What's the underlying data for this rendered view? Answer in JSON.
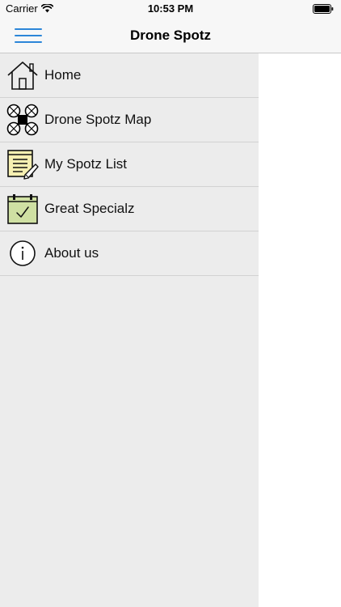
{
  "status_bar": {
    "carrier": "Carrier",
    "time": "10:53 PM"
  },
  "nav": {
    "title": "Drone Spotz",
    "accent_color": "#2c86d8"
  },
  "menu": {
    "items": [
      {
        "label": "Home",
        "icon": "home-icon"
      },
      {
        "label": "Drone Spotz Map",
        "icon": "drone-icon"
      },
      {
        "label": "My Spotz List",
        "icon": "notepad-icon"
      },
      {
        "label": "Great Specialz",
        "icon": "calendar-check-icon"
      },
      {
        "label": "About us",
        "icon": "info-icon"
      }
    ]
  }
}
